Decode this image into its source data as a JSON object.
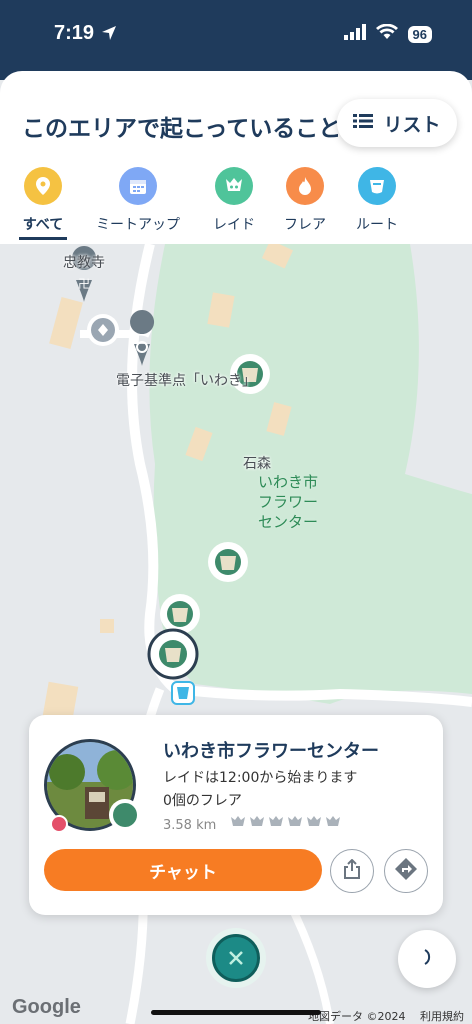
{
  "status_bar": {
    "time": "7:19",
    "battery": "96"
  },
  "header": {
    "title": "このエリアで起こっていること",
    "list_button_label": "リスト"
  },
  "tabs": [
    {
      "label": "すべて",
      "icon": "pin-icon",
      "color": "#f5c242",
      "active": true
    },
    {
      "label": "ミートアップ",
      "icon": "calendar-icon",
      "color": "#7fa8f5",
      "active": false
    },
    {
      "label": "レイド",
      "icon": "raid-icon",
      "color": "#4fc49a",
      "active": false
    },
    {
      "label": "フレア",
      "icon": "flame-icon",
      "color": "#f78c4a",
      "active": false
    },
    {
      "label": "ルート",
      "icon": "route-icon",
      "color": "#3fb6e6",
      "active": false
    }
  ],
  "map": {
    "labels": {
      "temple": "忠教寺",
      "benchmark": "電子基準点「いわき」",
      "area": "石森",
      "park": [
        "いわき市",
        "フラワー",
        "センター"
      ]
    },
    "colors": {
      "park": "#cfe9d7",
      "land": "#e6e9ec",
      "road": "#ffffff"
    }
  },
  "card": {
    "title": "いわき市フラワーセンター",
    "raid_info": "レイドは12:00から始まります",
    "flares": "0個のフレア",
    "distance": "3.58 km",
    "chat_button_label": "チャット"
  },
  "footer": {
    "google": "Google",
    "attribution": "地図データ ©2024　 利用規約"
  },
  "colors": {
    "primary": "#1f3b5c",
    "accent": "#f77c23",
    "teal": "#1c8a86"
  }
}
